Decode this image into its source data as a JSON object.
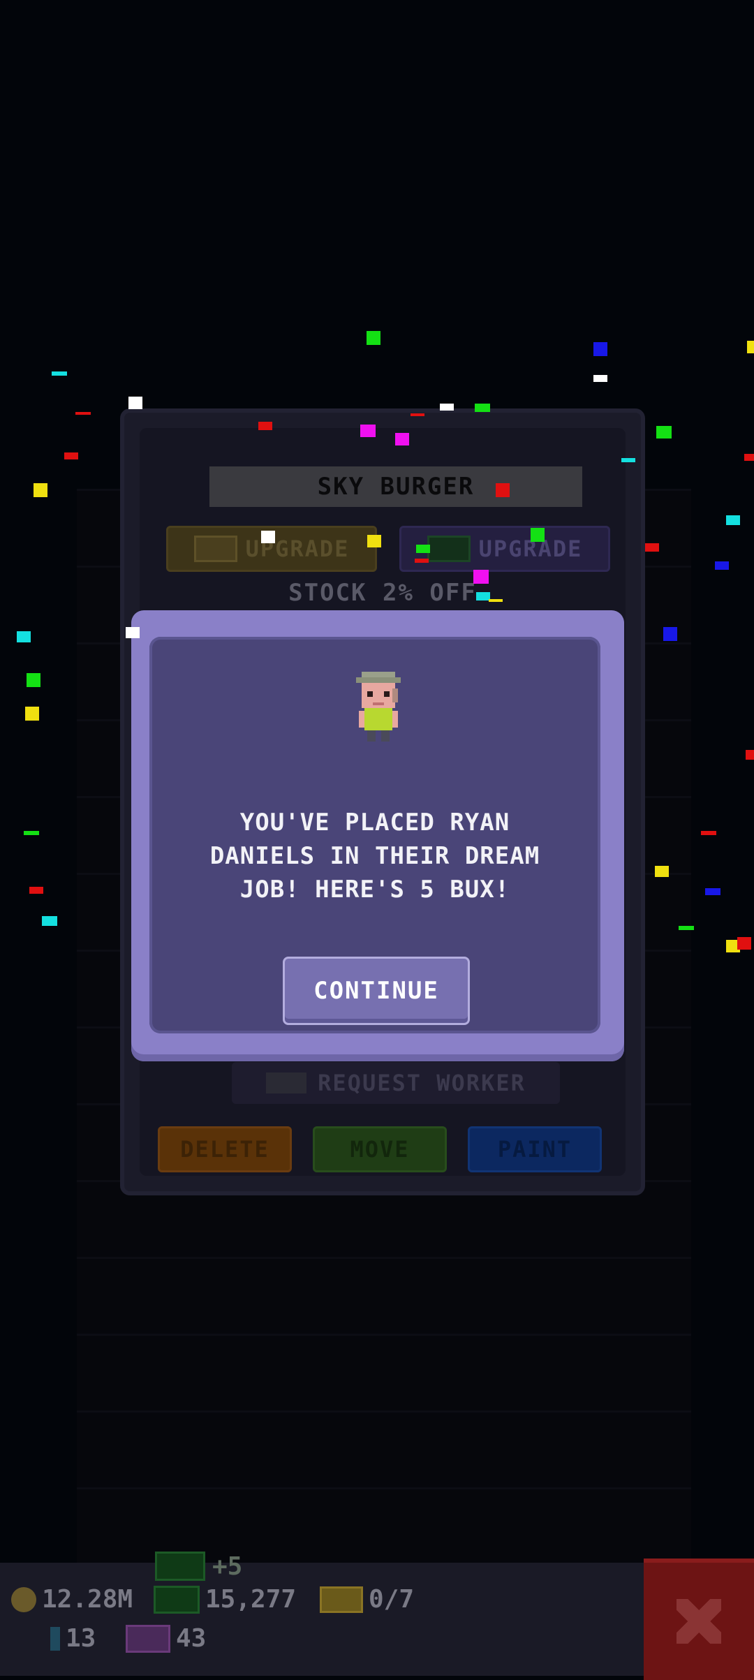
{
  "colors": {
    "dialog_frame": "#8a80c8",
    "dialog_panel": "#4a4578",
    "continue_button": "#7770b0",
    "upgrade_coins": "#3d3418",
    "upgrade_bux": "#241f40",
    "delete": "#5a3208",
    "move": "#1f3d15",
    "paint": "#0c2860",
    "close": "#6d1414"
  },
  "background_modal": {
    "floor_name": "SKY BURGER",
    "upgrade_coins_label": "UPGRADE",
    "upgrade_bux_label": "UPGRADE",
    "stock_label": "STOCK 2% OFF",
    "request_worker_label": "REQUEST WORKER",
    "delete_label": "DELETE",
    "move_label": "MOVE",
    "paint_label": "PAINT"
  },
  "dialog": {
    "message": "YOU'VE PLACED RYAN DANIELS IN THEIR DREAM JOB! HERE'S 5 BUX!",
    "continue_label": "CONTINUE",
    "worker_name": "RYAN DANIELS"
  },
  "bottom_bar": {
    "coins": "12.28M",
    "bux": "15,277",
    "bux_gain": "+5",
    "tickets": "0/7",
    "keys": "13",
    "vip": "43"
  },
  "icons": {
    "coin": "coin-icon",
    "bux": "bux-icon",
    "ticket": "ticket-icon",
    "key": "key-icon",
    "vip": "vip-icon",
    "close": "close-icon"
  }
}
